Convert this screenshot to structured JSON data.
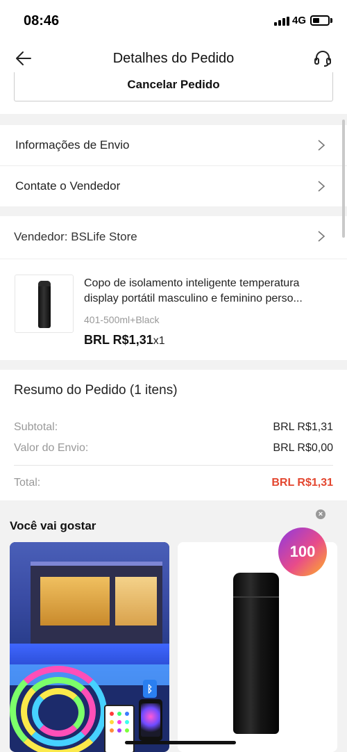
{
  "status_bar": {
    "time": "08:46",
    "network": "4G"
  },
  "header": {
    "title": "Detalhes do Pedido",
    "back_icon": "arrow-left-icon",
    "support_icon": "headset-icon"
  },
  "cancel_button": {
    "label": "Cancelar Pedido"
  },
  "menu": {
    "shipping_info": "Informações de Envio",
    "contact_seller": "Contate o Vendedor"
  },
  "seller": {
    "label": "Vendedor: BSLife Store"
  },
  "product": {
    "title_line1": "Copo de isolamento inteligente temperatura",
    "title_line2": "display portátil masculino e feminino perso...",
    "variant": "401-500ml+Black",
    "price": "BRL R$1,31",
    "quantity": "x1"
  },
  "summary": {
    "title": "Resumo do Pedido (1 itens)",
    "subtotal_label": "Subtotal:",
    "subtotal_value": "BRL R$1,31",
    "shipping_label": "Valor do Envio:",
    "shipping_value": "BRL R$0,00",
    "total_label": "Total:",
    "total_value": "BRL R$1,31",
    "total_color": "#e3462f"
  },
  "recommendations": {
    "title": "Você vai gostar",
    "badge": "100"
  }
}
